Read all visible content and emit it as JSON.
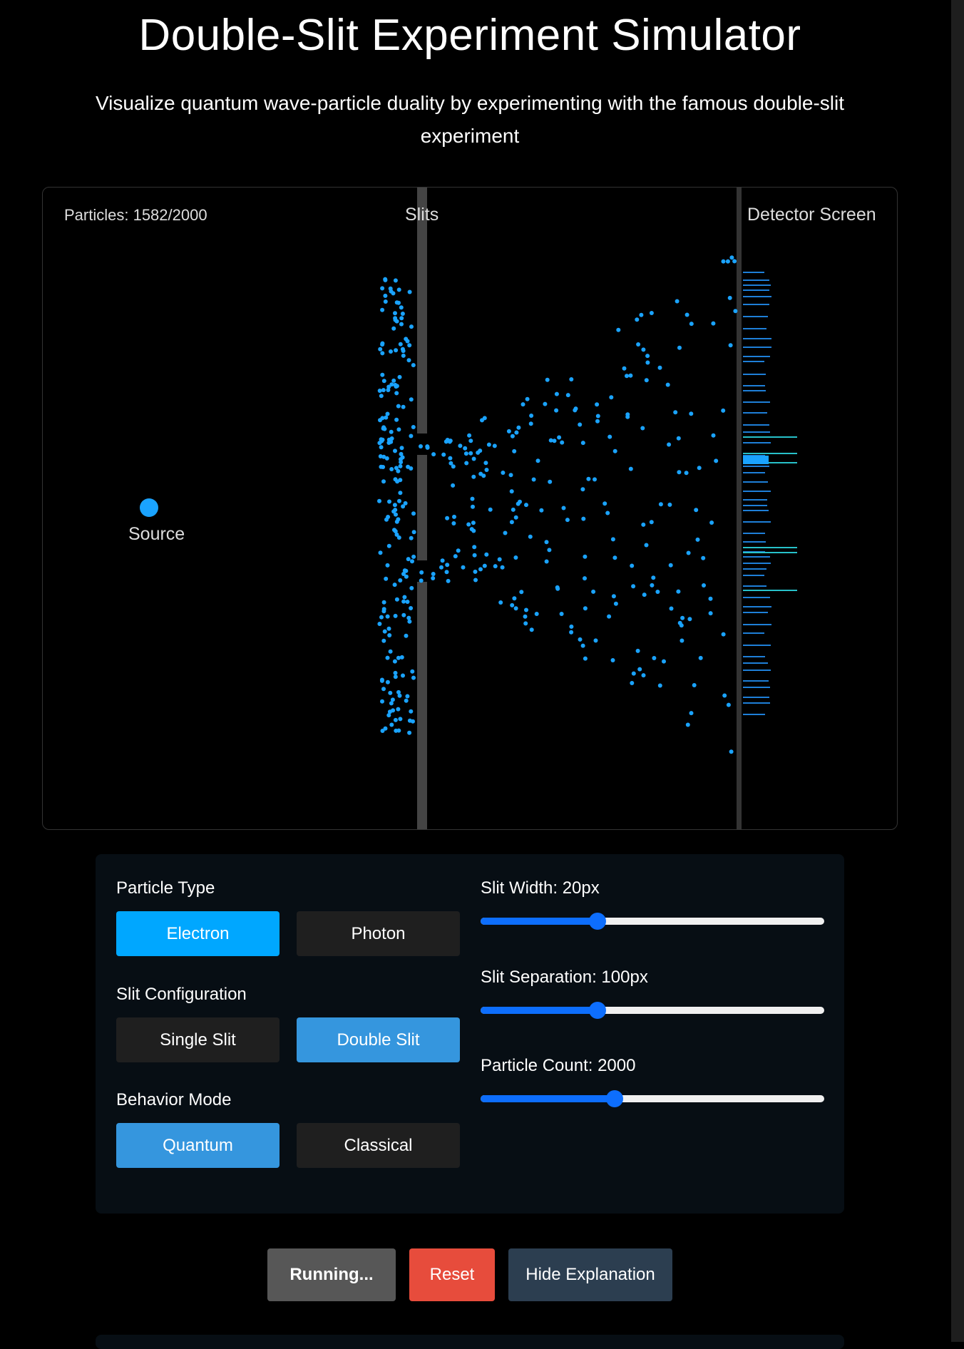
{
  "page": {
    "title": "Double-Slit Experiment Simulator",
    "subtitle": "Visualize quantum wave-particle duality by experimenting with the famous double-slit experiment"
  },
  "simulation": {
    "particle_counter": "Particles: 1582/2000",
    "slits_label": "Slits",
    "screen_label": "Detector Screen",
    "source_label": "Source",
    "colors": {
      "particle": "#1aa3ff",
      "barrier": "#444444",
      "screen": "#333333",
      "hit": "#1e7fd8",
      "hit_strong": "#27c1c9"
    }
  },
  "controls": {
    "particle_type": {
      "label": "Particle Type",
      "options": [
        "Electron",
        "Photon"
      ],
      "selected": "Electron"
    },
    "slit_configuration": {
      "label": "Slit Configuration",
      "options": [
        "Single Slit",
        "Double Slit"
      ],
      "selected": "Double Slit"
    },
    "behavior_mode": {
      "label": "Behavior Mode",
      "options": [
        "Quantum",
        "Classical"
      ],
      "selected": "Quantum"
    },
    "sliders": [
      {
        "label": "Slit Width: 20px",
        "fraction": 0.34
      },
      {
        "label": "Slit Separation: 100px",
        "fraction": 0.34
      },
      {
        "label": "Particle Count: 2000",
        "fraction": 0.39
      }
    ]
  },
  "actions": {
    "run_label": "Running...",
    "reset_label": "Reset",
    "explanation_label": "Hide Explanation"
  }
}
